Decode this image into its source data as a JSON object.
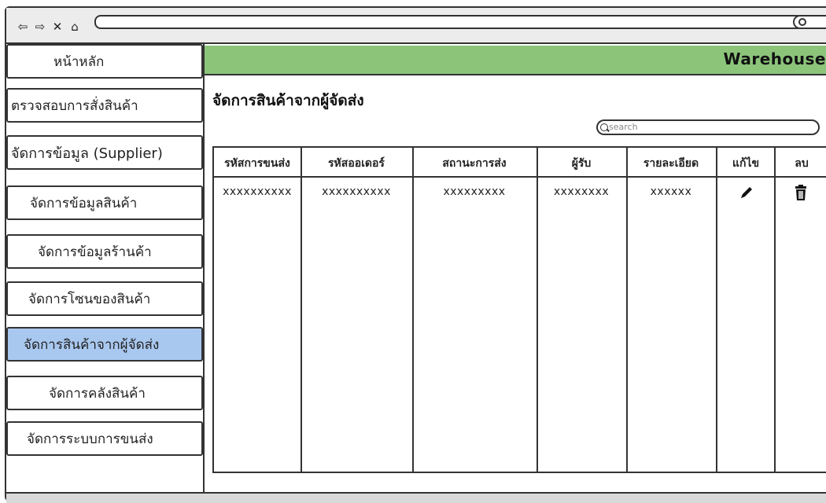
{
  "app": {
    "header_title": "Warehouse"
  },
  "sidebar": {
    "items": [
      {
        "label": "หน้าหลัก"
      },
      {
        "label": "ตรวจสอบการสั่งสินค้า"
      },
      {
        "label": "จัดการข้อมูล (Supplier)"
      },
      {
        "label": "จัดการข้อมูลสินค้า"
      },
      {
        "label": "จัดการข้อมูลร้านค้า"
      },
      {
        "label": "จัดการโซนของสินค้า"
      },
      {
        "label": "จัดการสินค้าจากผู้จัดส่ง",
        "active": true
      },
      {
        "label": "จัดการคลังสินค้า"
      },
      {
        "label": "จัดการระบบการขนส่ง"
      }
    ]
  },
  "main": {
    "title": "จัดการสินค้าจากผู้จัดส่ง",
    "search": {
      "placeholder": "search"
    },
    "table": {
      "headers": [
        "รหัสการขนส่ง",
        "รหัสออเดอร์",
        "สถานะการส่ง",
        "ผู้รับ",
        "รายละเอียด",
        "แก้ไข",
        "ลบ"
      ],
      "rows": [
        [
          "xxxxxxxxxx",
          "xxxxxxxxxx",
          "xxxxxxxxx",
          "xxxxxxxx",
          "xxxxxx"
        ]
      ]
    }
  },
  "colors": {
    "header_green": "#8cc47a",
    "active_blue": "#a9c8ef"
  },
  "icons": [
    "back-icon",
    "forward-icon",
    "close-icon",
    "home-icon",
    "search-icon",
    "edit-pencil-icon",
    "trash-icon"
  ]
}
